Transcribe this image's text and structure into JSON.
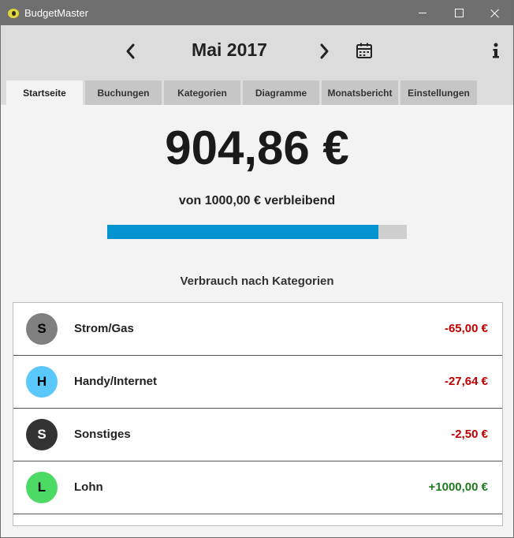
{
  "window": {
    "title": "BudgetMaster"
  },
  "header": {
    "month": "Mai 2017"
  },
  "tabs": [
    "Startseite",
    "Buchungen",
    "Kategorien",
    "Diagramme",
    "Monatsbericht",
    "Einstellungen"
  ],
  "active_tab": "Startseite",
  "summary": {
    "balance": "904,86 €",
    "remaining_text": "von 1000,00 € verbleibend",
    "remaining_fraction": 0.905,
    "progress_color": "#0093d0"
  },
  "categories_section": {
    "title": "Verbrauch nach Kategorien",
    "items": [
      {
        "initial": "S",
        "name": "Strom/Gas",
        "amount": "-65,00 €",
        "avatar_color": "#808080",
        "text_color": "#000000",
        "amount_color": "#c00000"
      },
      {
        "initial": "H",
        "name": "Handy/Internet",
        "amount": "-27,64 €",
        "avatar_color": "#5ac8fa",
        "text_color": "#000000",
        "amount_color": "#c00000"
      },
      {
        "initial": "S",
        "name": "Sonstiges",
        "amount": "-2,50 €",
        "avatar_color": "#333333",
        "text_color": "#ffffff",
        "amount_color": "#c00000"
      },
      {
        "initial": "L",
        "name": "Lohn",
        "amount": "+1000,00 €",
        "avatar_color": "#4cd964",
        "text_color": "#000000",
        "amount_color": "#1e7a1e"
      }
    ]
  }
}
